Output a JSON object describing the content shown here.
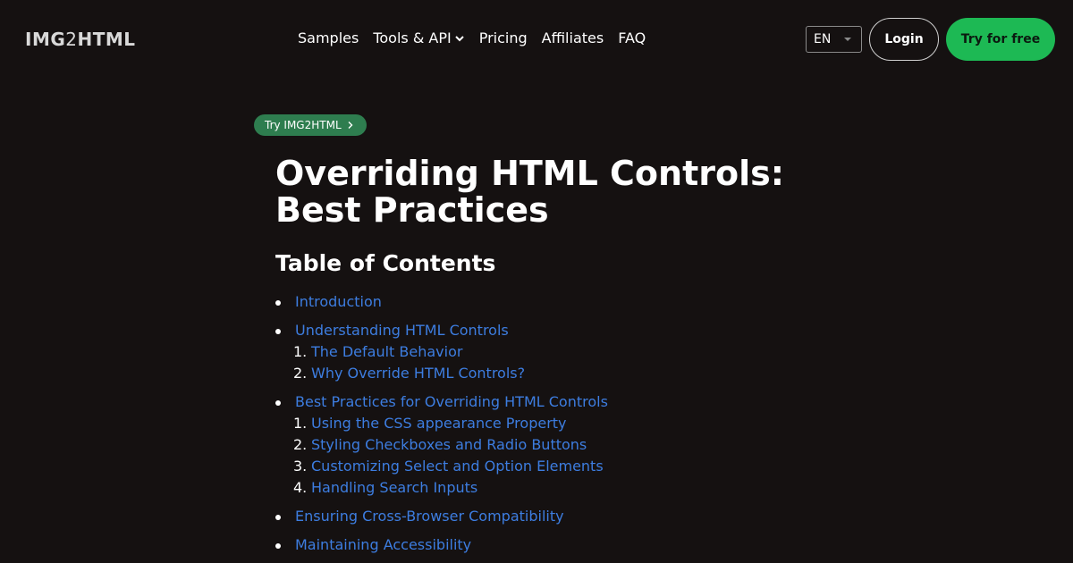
{
  "header": {
    "logo_prefix": "IMG",
    "logo_two": "2",
    "logo_suffix": "HTML",
    "nav": {
      "samples": "Samples",
      "tools": "Tools & API",
      "pricing": "Pricing",
      "affiliates": "Affiliates",
      "faq": "FAQ"
    },
    "language": "EN",
    "login": "Login",
    "try_free": "Try for free"
  },
  "badge": {
    "label": "Try IMG2HTML"
  },
  "article": {
    "title": "Overriding HTML Controls: Best Practices",
    "toc_heading": "Table of Contents"
  },
  "toc": [
    {
      "label": "Introduction",
      "children": []
    },
    {
      "label": "Understanding HTML Controls",
      "children": [
        {
          "num": "1.",
          "label": "The Default Behavior"
        },
        {
          "num": "2.",
          "label": "Why Override HTML Controls?"
        }
      ]
    },
    {
      "label": "Best Practices for Overriding HTML Controls",
      "children": [
        {
          "num": "1.",
          "label": "Using the CSS appearance Property"
        },
        {
          "num": "2.",
          "label": "Styling Checkboxes and Radio Buttons"
        },
        {
          "num": "3.",
          "label": "Customizing Select and Option Elements"
        },
        {
          "num": "4.",
          "label": "Handling Search Inputs"
        }
      ]
    },
    {
      "label": "Ensuring Cross-Browser Compatibility",
      "children": []
    },
    {
      "label": "Maintaining Accessibility",
      "children": []
    }
  ],
  "colors": {
    "background": "#151111",
    "link": "#3d7de0",
    "accent_green": "#1db954",
    "badge_green": "#2e7d4f"
  },
  "icons": {
    "tools_dropdown": "chevron-down-icon",
    "badge_arrow": "chevron-right-icon",
    "language_caret": "caret-down-icon"
  }
}
